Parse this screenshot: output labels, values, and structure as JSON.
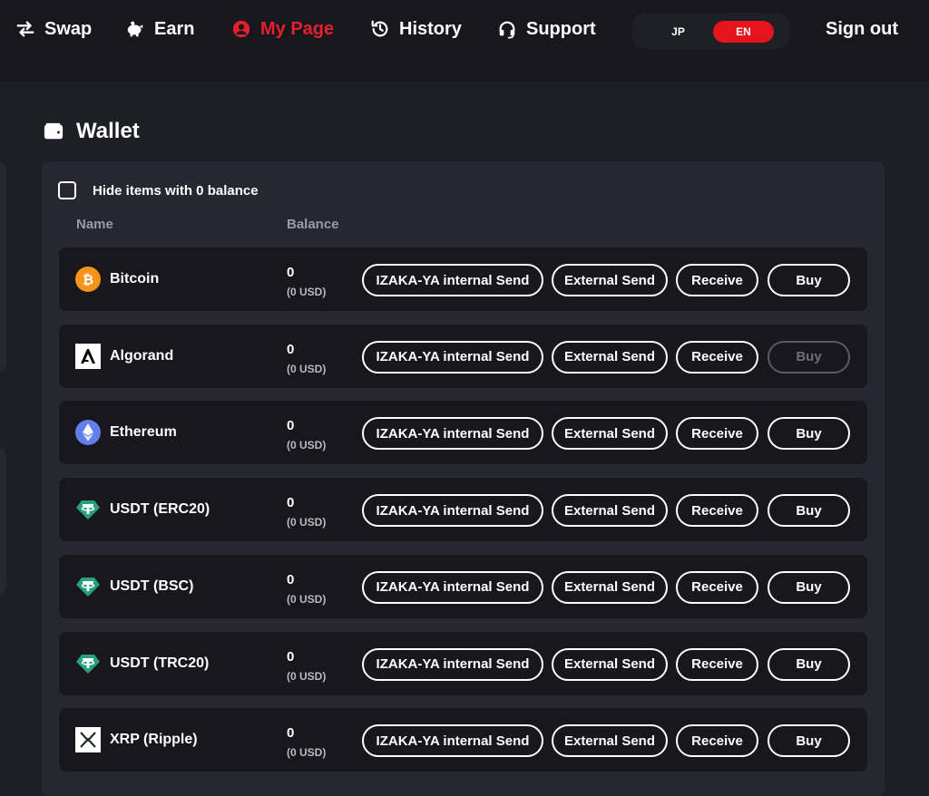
{
  "nav": {
    "items": [
      {
        "label": "Swap",
        "icon": "swap-arrows-icon"
      },
      {
        "label": "Earn",
        "icon": "piggy-bank-icon"
      },
      {
        "label": "My Page",
        "icon": "user-circle-icon",
        "active": true
      },
      {
        "label": "History",
        "icon": "history-clock-icon"
      },
      {
        "label": "Support",
        "icon": "headset-icon"
      }
    ],
    "lang": {
      "jp": "JP",
      "en": "EN",
      "selected": "EN"
    },
    "signout": "Sign out",
    "active_color": "#e5202d"
  },
  "wallet": {
    "title": "Wallet",
    "hide_zero_label": "Hide items with 0 balance",
    "hide_zero_checked": false,
    "columns": {
      "name": "Name",
      "balance": "Balance"
    },
    "buttons": {
      "internal_send": "IZAKA-YA internal Send",
      "external_send": "External Send",
      "receive": "Receive",
      "buy": "Buy"
    },
    "rows": [
      {
        "name": "Bitcoin",
        "balance": "0",
        "usd": "(0 USD)",
        "icon": "bitcoin-icon",
        "buy_enabled": true
      },
      {
        "name": "Algorand",
        "balance": "0",
        "usd": "(0 USD)",
        "icon": "algorand-icon",
        "buy_enabled": false
      },
      {
        "name": "Ethereum",
        "balance": "0",
        "usd": "(0 USD)",
        "icon": "ethereum-icon",
        "buy_enabled": true
      },
      {
        "name": "USDT (ERC20)",
        "balance": "0",
        "usd": "(0 USD)",
        "icon": "tether-icon",
        "buy_enabled": true
      },
      {
        "name": "USDT (BSC)",
        "balance": "0",
        "usd": "(0 USD)",
        "icon": "tether-icon",
        "buy_enabled": true
      },
      {
        "name": "USDT (TRC20)",
        "balance": "0",
        "usd": "(0 USD)",
        "icon": "tether-icon",
        "buy_enabled": true
      },
      {
        "name": "XRP (Ripple)",
        "balance": "0",
        "usd": "(0 USD)",
        "icon": "xrp-icon",
        "buy_enabled": true
      }
    ]
  }
}
